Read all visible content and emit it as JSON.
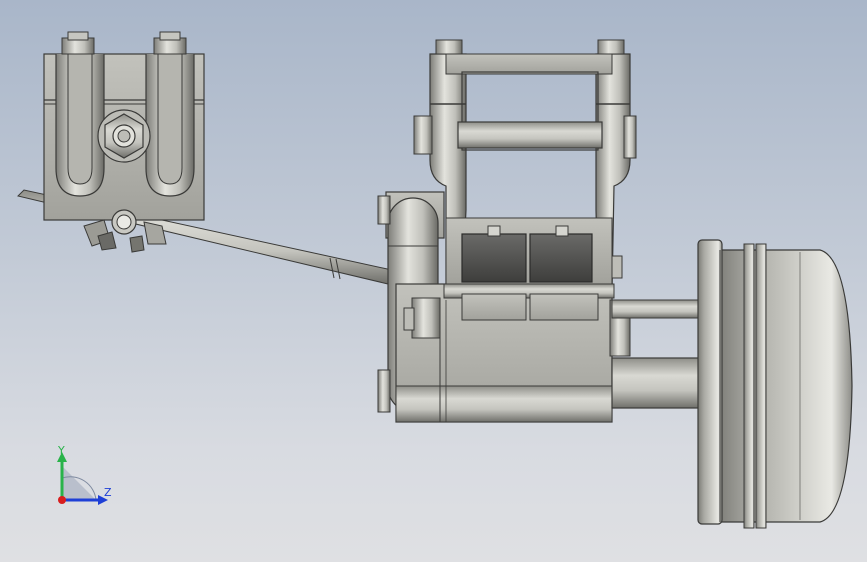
{
  "viewport": {
    "background_top": "#a9b6c9",
    "background_bottom": "#dfe0e3"
  },
  "triad": {
    "y_label": "Y",
    "z_label": "Z",
    "y_color": "#29b34a",
    "z_color": "#1e3fd6",
    "x_color": "#d81e1e"
  },
  "model": {
    "body_color": "#b3b3ad",
    "dark_color": "#4a4a48",
    "pad_color": "#5a5a58"
  }
}
